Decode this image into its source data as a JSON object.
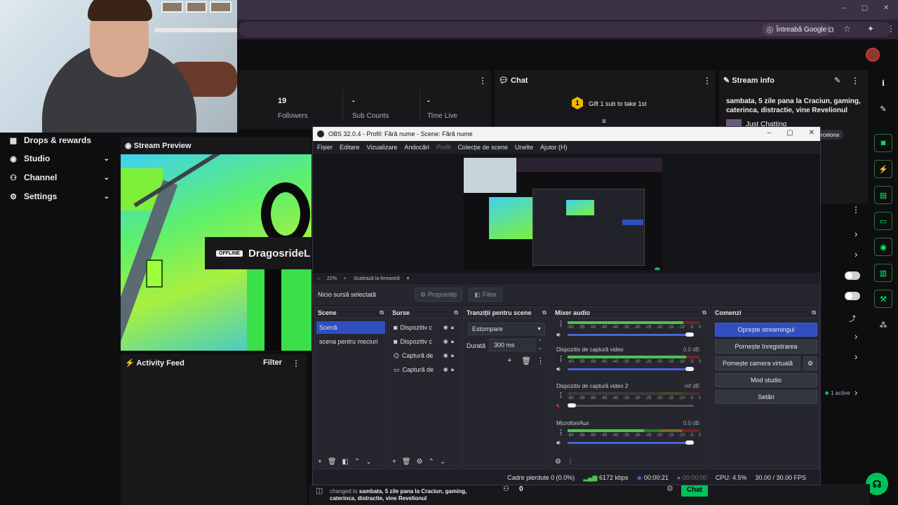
{
  "browser": {
    "ask_google": "Întreabă Google",
    "win_min": "–",
    "win_max": "▢",
    "win_close": "✕"
  },
  "nav": {
    "items": [
      {
        "label": "Drops & rewards",
        "icon": "gift-icon"
      },
      {
        "label": "Studio",
        "icon": "studio-icon"
      },
      {
        "label": "Channel",
        "icon": "channel-icon"
      },
      {
        "label": "Settings",
        "icon": "gear-icon"
      }
    ]
  },
  "stats": {
    "followers_value": "19",
    "followers_label": "Followers",
    "subs_value": "-",
    "subs_label": "Sub Counts",
    "time_value": "-",
    "time_label": "Time Live"
  },
  "chat": {
    "title": "Chat",
    "gift_badge": "1",
    "gift_text": "Gift 1 sub to take 1st"
  },
  "stream_info": {
    "title": "Stream info",
    "text": "sambata, 5 zile pana la Craciun, gaming, caterinca, distractie, vine Revelionul",
    "category": "Just Chatting",
    "tag": "barcelona"
  },
  "preview": {
    "title": "Stream Preview",
    "offline_badge": "OFFLINE",
    "channel_name": "DragosrideL"
  },
  "feed": {
    "title": "Activity Feed",
    "filter": "Filter"
  },
  "quick": {
    "active_label": "1 active"
  },
  "bottom": {
    "changed_prefix": "changed to ",
    "changed_text": "sambata, 5 zile pana la Craciun, gaming, caterinca, distractie, vine Revelionul",
    "zero": "0",
    "chat_button": "Chat"
  },
  "obs": {
    "title": "OBS 32.0.4 - Profil: Fără nume - Scene: Fără nume",
    "menu": [
      {
        "label": "Fișier",
        "disabled": false
      },
      {
        "label": "Editare",
        "disabled": false
      },
      {
        "label": "Vizualizare",
        "disabled": false
      },
      {
        "label": "Andocări",
        "disabled": false
      },
      {
        "label": "Profil",
        "disabled": true
      },
      {
        "label": "Colecție de scene",
        "disabled": false
      },
      {
        "label": "Unelte",
        "disabled": false
      },
      {
        "label": "Ajutor (H)",
        "disabled": false
      }
    ],
    "zoom": {
      "minus": "–",
      "value": "22%",
      "plus": "+",
      "scale_label": "Scalează la fereastră"
    },
    "source_bar": {
      "no_source": "Nicio sursă selectată",
      "properties": "Proprietăți",
      "filters": "Filtre"
    },
    "scenes": {
      "title": "Scene",
      "items": [
        "Scenă",
        "scena pentru meciuri"
      ]
    },
    "sources": {
      "title": "Surse",
      "items": [
        {
          "label": "Dispozitiv c",
          "icon": "camera-icon"
        },
        {
          "label": "Dispozitiv c",
          "icon": "camera-icon"
        },
        {
          "label": "Captură de",
          "icon": "gamepad-icon"
        },
        {
          "label": "Captură de",
          "icon": "monitor-icon"
        }
      ]
    },
    "transitions": {
      "title": "Tranziții pentru scene",
      "selected": "Estompare",
      "duration_label": "Durată",
      "duration_value": "300 ms"
    },
    "mixer": {
      "title": "Mixer audio",
      "scale": [
        "-60",
        "-55",
        "-50",
        "-45",
        "-40",
        "-35",
        "-30",
        "-25",
        "-20",
        "-15",
        "-10",
        "-5",
        "0"
      ],
      "channels": [
        {
          "name": "",
          "db": "",
          "level": 0.88,
          "volume": 1.0,
          "muted": false
        },
        {
          "name": "Dispozitiv de captură video",
          "db": "0.0 dB",
          "level": 0.9,
          "volume": 1.0,
          "muted": false
        },
        {
          "name": "Dispozitiv de captură video 2",
          "db": "-inf dB",
          "level": 0.0,
          "volume": 0.0,
          "muted": true
        },
        {
          "name": "Microfon/Aux",
          "db": "0.0 dB",
          "level": 0.58,
          "volume": 1.0,
          "muted": false
        }
      ]
    },
    "controls": {
      "title": "Comenzi",
      "stop_stream": "Oprește streamingul",
      "start_record": "Pornește înregistrarea",
      "virtual_cam": "Pornește camera virtuală",
      "studio_mode": "Mod studio",
      "settings": "Setări"
    },
    "status": {
      "dropped": "Cadre pierdute 0 (0.0%)",
      "bitrate": "6172 kbps",
      "stream_time": "00:00:21",
      "rec_time": "00:00:00",
      "cpu": "CPU: 4.5%",
      "fps": "30.00 / 30.00 FPS"
    }
  },
  "colors": {
    "accent_green": "#00c15a",
    "obs_blue": "#2f4fc0",
    "panel": "#18181b"
  }
}
